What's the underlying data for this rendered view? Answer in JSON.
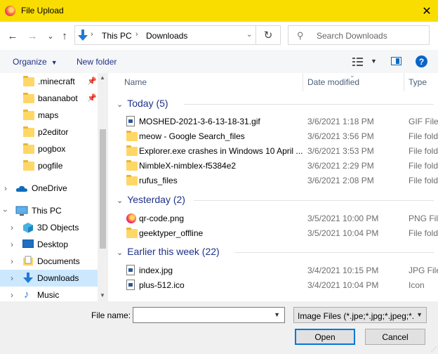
{
  "window": {
    "title": "File Upload",
    "close_label": "✕"
  },
  "nav": {
    "back": "←",
    "forward": "→",
    "recent": "⌄",
    "up": "↑",
    "breadcrumb": [
      "This PC",
      "Downloads"
    ],
    "refresh": "↻",
    "search_placeholder": "Search Downloads"
  },
  "toolbar": {
    "organize": "Organize",
    "new_folder": "New folder",
    "help": "?"
  },
  "sidebar": {
    "quick_access": [
      ".minecraft",
      "bananabot",
      "maps",
      "p2editor",
      "pogbox",
      "pogfile"
    ],
    "onedrive": "OneDrive",
    "this_pc": "This PC",
    "pc_items": [
      "3D Objects",
      "Desktop",
      "Documents",
      "Downloads",
      "Music"
    ]
  },
  "columns": {
    "name": "Name",
    "date": "Date modified",
    "type": "Type"
  },
  "groups": [
    {
      "label": "Today (5)",
      "files": [
        {
          "name": "MOSHED-2021-3-6-13-18-31.gif",
          "date": "3/6/2021 1:18 PM",
          "type": "GIF File",
          "icon": "image-file-icon"
        },
        {
          "name": "meow - Google Search_files",
          "date": "3/6/2021 3:56 PM",
          "type": "File folder",
          "icon": "folder-icon"
        },
        {
          "name": "Explorer.exe crashes in Windows 10 April ...",
          "date": "3/6/2021 3:53 PM",
          "type": "File folder",
          "icon": "folder-icon"
        },
        {
          "name": "NimbleX-nimblex-f5384e2",
          "date": "3/6/2021 2:29 PM",
          "type": "File folder",
          "icon": "folder-icon"
        },
        {
          "name": "rufus_files",
          "date": "3/6/2021 2:08 PM",
          "type": "File folder",
          "icon": "folder-icon"
        }
      ]
    },
    {
      "label": "Yesterday (2)",
      "files": [
        {
          "name": "qr-code.png",
          "date": "3/5/2021 10:00 PM",
          "type": "PNG File",
          "icon": "firefox-png-icon"
        },
        {
          "name": "geektyper_offline",
          "date": "3/5/2021 10:04 PM",
          "type": "File folder",
          "icon": "folder-icon"
        }
      ]
    },
    {
      "label": "Earlier this week (22)",
      "files": [
        {
          "name": "index.jpg",
          "date": "3/4/2021 10:15 PM",
          "type": "JPG File",
          "icon": "image-file-icon"
        },
        {
          "name": "plus-512.ico",
          "date": "3/4/2021 10:04 PM",
          "type": "Icon",
          "icon": "image-file-icon"
        }
      ]
    }
  ],
  "bottom": {
    "file_name_label": "File name:",
    "file_name_value": "",
    "filter": "Image Files (*.jpe;*.jpg;*.jpeg;*.",
    "open": "Open",
    "cancel": "Cancel"
  },
  "colors": {
    "title_bar": "#f9dd00",
    "selection": "#cce8ff",
    "group_header": "#1e3287",
    "accent": "#0078d7"
  }
}
